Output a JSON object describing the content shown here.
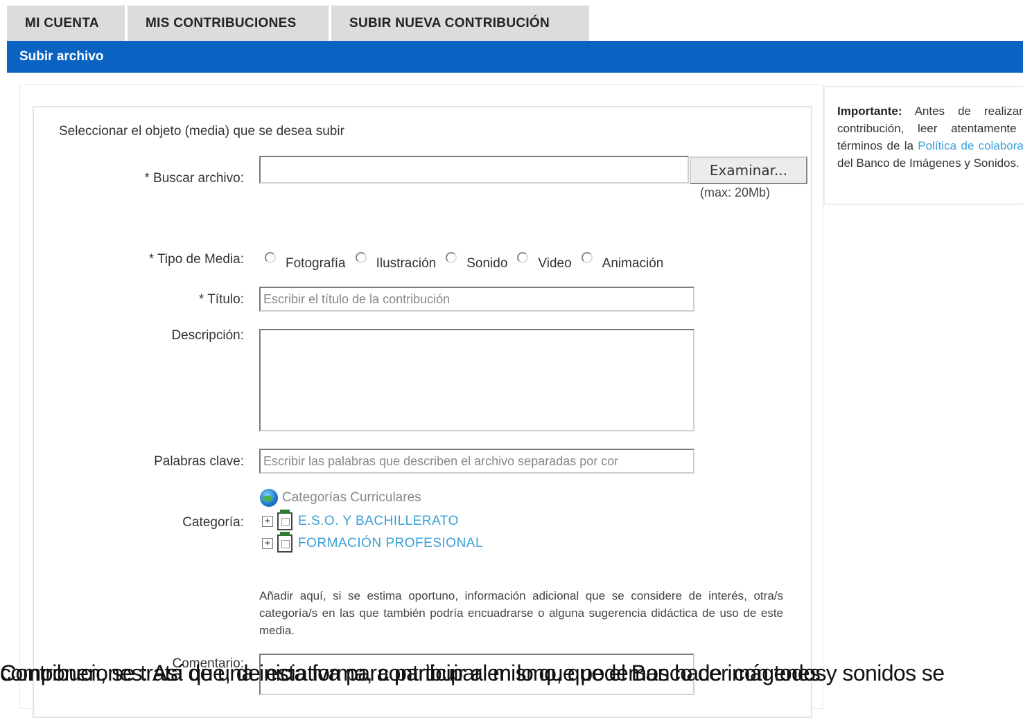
{
  "tabs": [
    {
      "label": "MI CUENTA"
    },
    {
      "label": "MIS CONTRIBUCIONES"
    },
    {
      "label": "SUBIR NUEVA CONTRIBUCIÓN"
    }
  ],
  "section_title": "Subir archivo",
  "form": {
    "intro": "Seleccionar el objeto (media) que se desea subir",
    "file": {
      "label": "* Buscar archivo:",
      "value": "",
      "browse_label": "Examinar...",
      "max_note": "(max: 20Mb)"
    },
    "media_type": {
      "label": "* Tipo de Media:",
      "options": [
        "Fotografía",
        "Ilustración",
        "Sonido",
        "Video",
        "Animación"
      ]
    },
    "title": {
      "label": "* Título:",
      "placeholder": "Escribir el título de la contribución"
    },
    "description": {
      "label": "Descripción:",
      "value": ""
    },
    "keywords": {
      "label": "Palabras clave:",
      "placeholder": "Escribir las palabras que describen el archivo separadas por cor"
    },
    "category": {
      "label": "Categoría:",
      "root": "Categorías Curriculares",
      "nodes": [
        "E.S.O. Y BACHILLERATO",
        "FORMACIÓN PROFESIONAL"
      ],
      "expander_symbol": "+"
    },
    "help_text": "Añadir aquí, si se estima oportuno, información adicional que se considere de interés, otra/s categoría/s en las que también podría encuadrarse o alguna sugerencia didáctica de uso de este media.",
    "comment": {
      "label": "Comentario:"
    }
  },
  "sidebar": {
    "important_label": "Importante:",
    "text_before_link": " Antes de realizar la contribución, leer atentamente los términos de la ",
    "link_text": "Política de colaboración",
    "text_after_link": " del Banco de Imágenes y Sonidos."
  },
  "overlap_lines": [
    "Contribuciones: Así que, de esta forma, contribuir al mismo, que el Banco de imágenes y sonidos se",
    "componen, se trata de una iniciativa para participar en lo que podemos hacer con todos"
  ]
}
